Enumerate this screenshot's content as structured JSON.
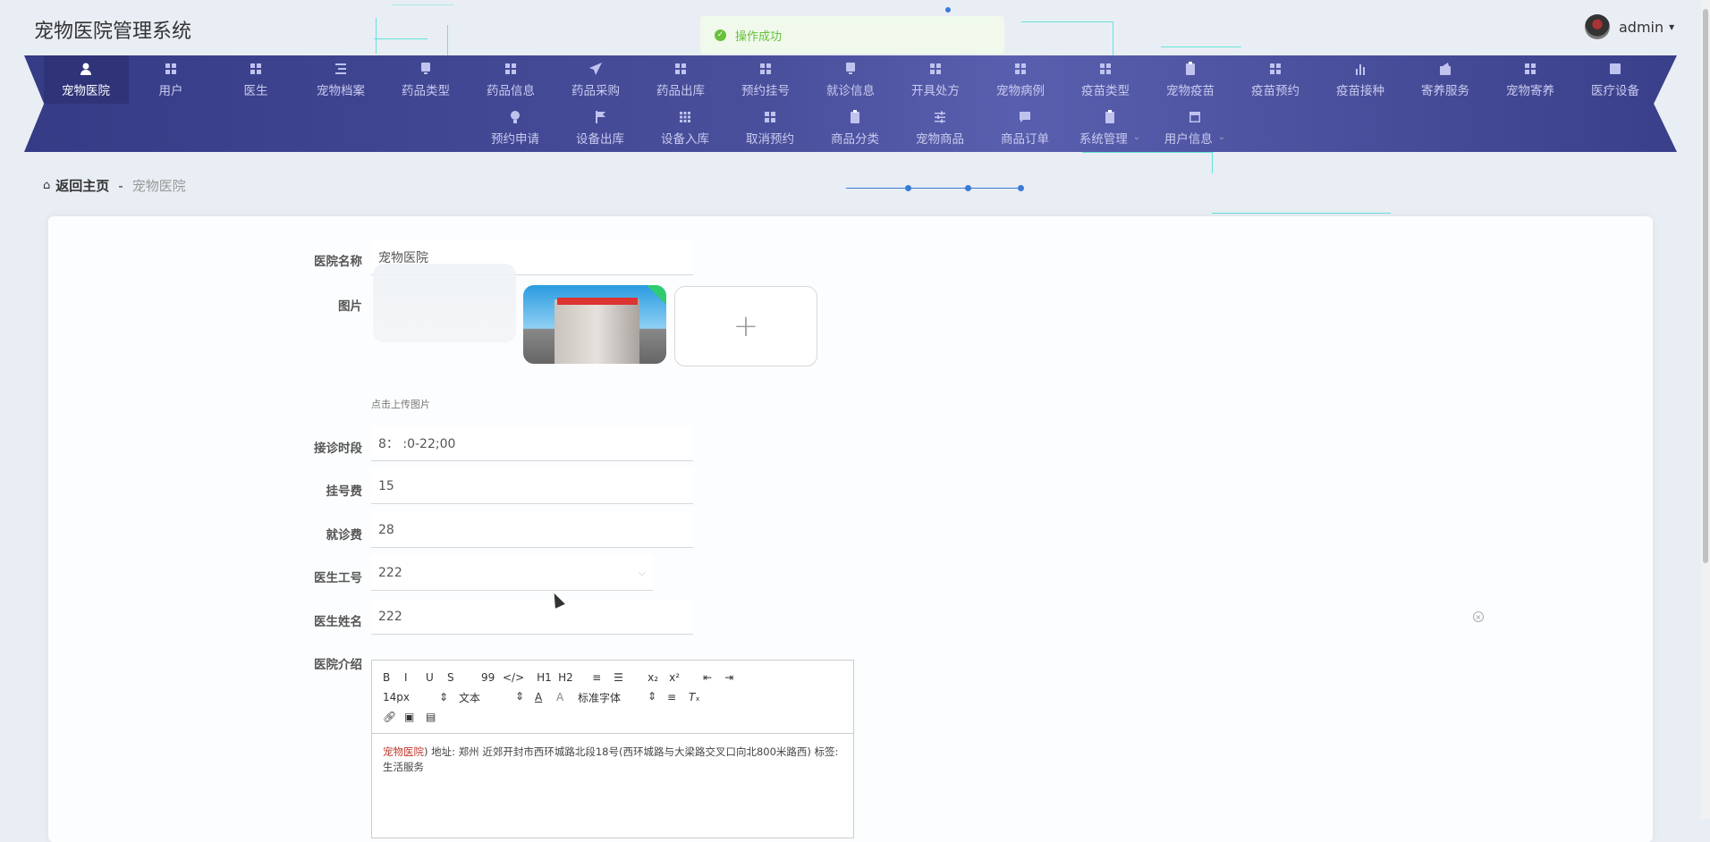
{
  "app_title": "宠物医院管理系统",
  "toast": "操作成功",
  "user": {
    "name": "admin",
    "caret": "▾"
  },
  "nav_row1": [
    {
      "label": "宠物医院",
      "icon": "user",
      "active": true
    },
    {
      "label": "用户",
      "icon": "grid"
    },
    {
      "label": "医生",
      "icon": "grid"
    },
    {
      "label": "宠物档案",
      "icon": "list"
    },
    {
      "label": "药品类型",
      "icon": "monitor"
    },
    {
      "label": "药品信息",
      "icon": "grid"
    },
    {
      "label": "药品采购",
      "icon": "send"
    },
    {
      "label": "药品出库",
      "icon": "grid"
    },
    {
      "label": "预约挂号",
      "icon": "grid"
    },
    {
      "label": "就诊信息",
      "icon": "monitor"
    },
    {
      "label": "开具处方",
      "icon": "grid"
    },
    {
      "label": "宠物病例",
      "icon": "grid"
    },
    {
      "label": "疫苗类型",
      "icon": "grid"
    },
    {
      "label": "宠物疫苗",
      "icon": "clipboard"
    },
    {
      "label": "疫苗预约",
      "icon": "grid"
    },
    {
      "label": "疫苗接种",
      "icon": "bar-chart"
    },
    {
      "label": "寄养服务",
      "icon": "wallet"
    },
    {
      "label": "宠物寄养",
      "icon": "grid"
    },
    {
      "label": "医疗设备",
      "icon": "chart"
    }
  ],
  "nav_row2": [
    {
      "label": "预约申请",
      "icon": "bulb"
    },
    {
      "label": "设备出库",
      "icon": "flag"
    },
    {
      "label": "设备入库",
      "icon": "grid9"
    },
    {
      "label": "取消预约",
      "icon": "grid"
    },
    {
      "label": "商品分类",
      "icon": "clipboard"
    },
    {
      "label": "宠物商品",
      "icon": "sliders"
    },
    {
      "label": "商品订单",
      "icon": "message"
    },
    {
      "label": "系统管理",
      "icon": "clipboard",
      "dropdown": "⌄"
    },
    {
      "label": "用户信息",
      "icon": "window",
      "dropdown": "⌄"
    }
  ],
  "breadcrumb": {
    "home": "返回主页",
    "sep": "-",
    "current": "宠物医院"
  },
  "form": {
    "name_label": "医院名称",
    "name_value": "宠物医院",
    "image_label": "图片",
    "upload_plus": "+",
    "upload_hint": "点击上传图片",
    "hours_label": "接诊时段",
    "hours_value": "8： :0-22;00",
    "reg_fee_label": "挂号费",
    "reg_fee_value": "15",
    "visit_fee_label": "就诊费",
    "visit_fee_value": "28",
    "doctor_id_label": "医生工号",
    "doctor_id_value": "222",
    "doctor_name_label": "医生姓名",
    "doctor_name_value": "222",
    "intro_label": "医院介绍"
  },
  "editor": {
    "toolbar1": [
      "B",
      "I",
      "U",
      "S",
      "99",
      "</>",
      "H1",
      "H2",
      "≡",
      "☰",
      "x₂",
      "x²",
      "⇤",
      "⇥"
    ],
    "font_size": "14px",
    "block": "文本",
    "font_family": "标准字体",
    "content_highlight": "宠物医院",
    "content_rest": ") 地址: 郑州 近郊开封市西环城路北段18号(西环城路与大梁路交叉口向北800米路西) 标签: 生活服务"
  }
}
